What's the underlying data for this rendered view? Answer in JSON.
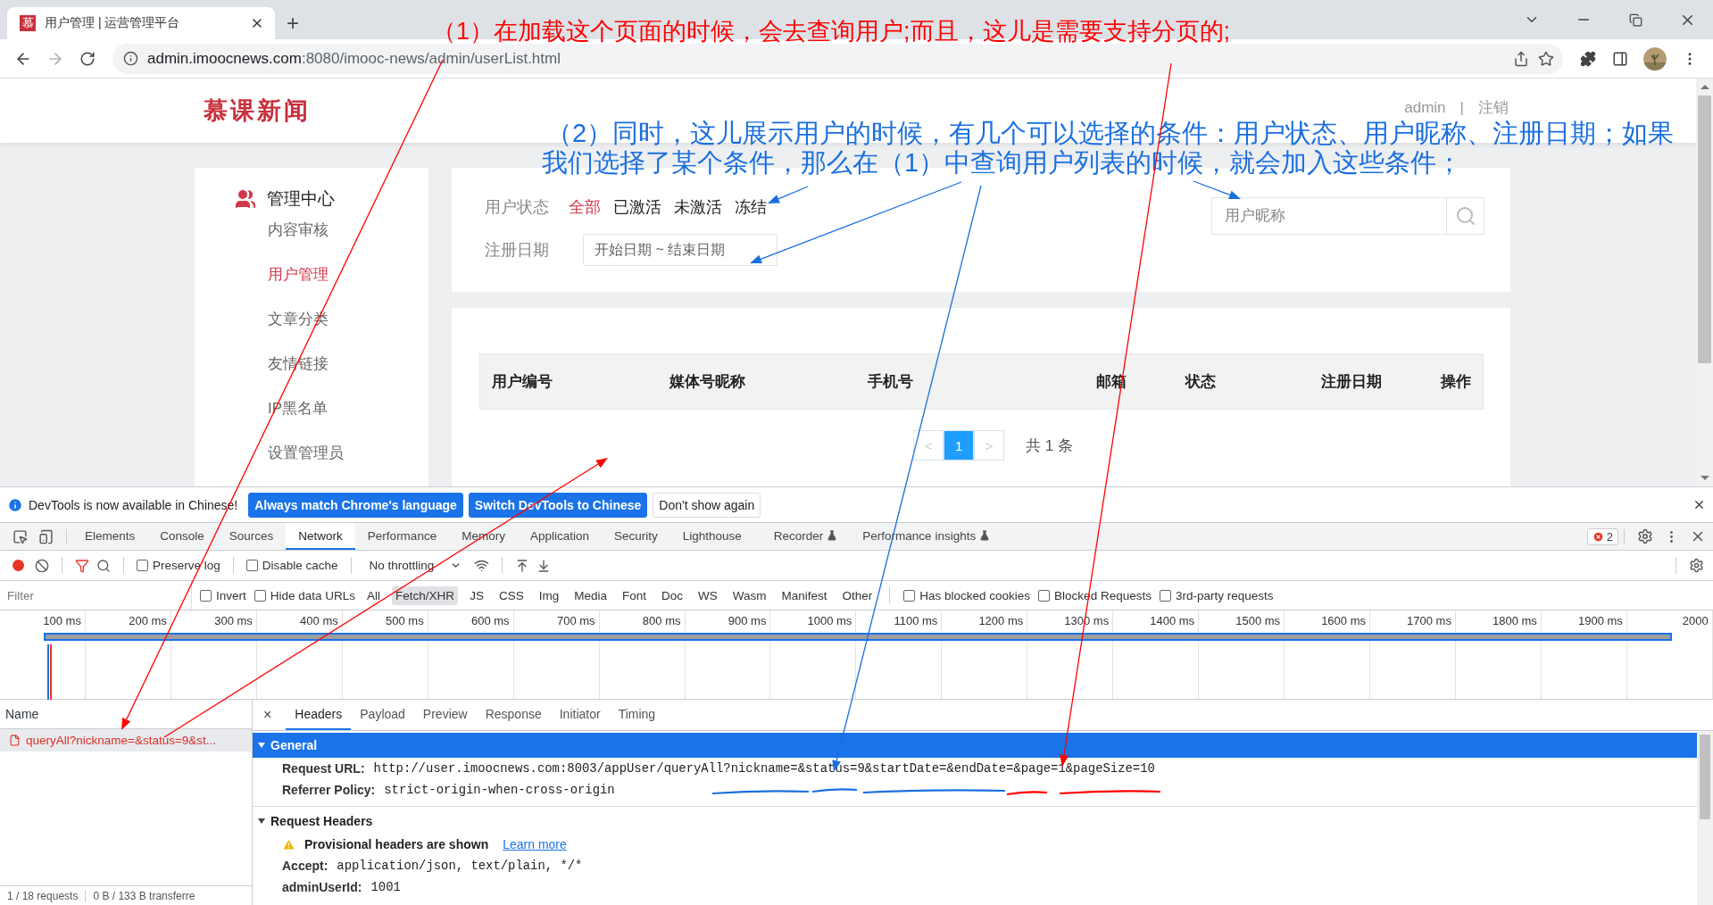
{
  "browser": {
    "favicon": "慕",
    "tab_title": "用户管理 | 运营管理平台",
    "new_tab": "+",
    "url_host": "admin.imoocnews.com",
    "url_path": ":8080/imooc-news/admin/userList.html"
  },
  "site": {
    "logo": "慕课新闻",
    "user": "admin",
    "separator": "|",
    "logout": "注销"
  },
  "sidebar": {
    "title": "管理中心",
    "items": [
      {
        "label": "内容审核",
        "selected": false
      },
      {
        "label": "用户管理",
        "selected": true
      },
      {
        "label": "文章分类",
        "selected": false
      },
      {
        "label": "友情链接",
        "selected": false
      },
      {
        "label": "IP黑名单",
        "selected": false
      },
      {
        "label": "设置管理员",
        "selected": false
      }
    ]
  },
  "filters": {
    "status_label": "用户状态",
    "statuses": [
      {
        "label": "全部",
        "selected": true
      },
      {
        "label": "已激活",
        "selected": false
      },
      {
        "label": "未激活",
        "selected": false
      },
      {
        "label": "冻结",
        "selected": false
      }
    ],
    "date_label": "注册日期",
    "date_placeholder": "开始日期 ~ 结束日期",
    "search_placeholder": "用户昵称"
  },
  "table": {
    "columns": [
      "用户编号",
      "媒体号昵称",
      "手机号",
      "邮箱",
      "状态",
      "注册日期",
      "操作"
    ]
  },
  "pagination": {
    "prev": "<",
    "pages": [
      {
        "label": "1",
        "selected": true
      }
    ],
    "next": ">",
    "total": "共 1 条"
  },
  "devtools": {
    "notice": {
      "text": "DevTools is now available in Chinese!",
      "buttons": [
        {
          "label": "Always match Chrome's language",
          "kind": "primary"
        },
        {
          "label": "Switch DevTools to Chinese",
          "kind": "primary"
        },
        {
          "label": "Don't show again",
          "kind": "plain"
        }
      ]
    },
    "panels": [
      {
        "label": "Elements",
        "selected": false,
        "experimental": false
      },
      {
        "label": "Console",
        "selected": false,
        "experimental": false
      },
      {
        "label": "Sources",
        "selected": false,
        "experimental": false
      },
      {
        "label": "Network",
        "selected": true,
        "experimental": false
      },
      {
        "label": "Performance",
        "selected": false,
        "experimental": false
      },
      {
        "label": "Memory",
        "selected": false,
        "experimental": false
      },
      {
        "label": "Application",
        "selected": false,
        "experimental": false
      },
      {
        "label": "Security",
        "selected": false,
        "experimental": false
      },
      {
        "label": "Lighthouse",
        "selected": false,
        "experimental": false
      },
      {
        "label": "Recorder",
        "selected": false,
        "experimental": true
      },
      {
        "label": "Performance insights",
        "selected": false,
        "experimental": true
      }
    ],
    "error_count": "2",
    "toolbar": {
      "recording": true,
      "options": [
        {
          "label": "Preserve log",
          "checked": false
        },
        {
          "label": "Disable cache",
          "checked": false
        }
      ],
      "throttling": "No throttling"
    },
    "filter_bar": {
      "placeholder": "Filter",
      "options": [
        {
          "label": "Invert",
          "checked": false
        },
        {
          "label": "Hide data URLs",
          "checked": false
        }
      ],
      "types": [
        {
          "label": "All",
          "selected": false
        },
        {
          "label": "Fetch/XHR",
          "selected": true
        },
        {
          "label": "JS",
          "selected": false
        },
        {
          "label": "CSS",
          "selected": false
        },
        {
          "label": "Img",
          "selected": false
        },
        {
          "label": "Media",
          "selected": false
        },
        {
          "label": "Font",
          "selected": false
        },
        {
          "label": "Doc",
          "selected": false
        },
        {
          "label": "WS",
          "selected": false
        },
        {
          "label": "Wasm",
          "selected": false
        },
        {
          "label": "Manifest",
          "selected": false
        },
        {
          "label": "Other",
          "selected": false
        }
      ],
      "extra_options": [
        {
          "label": "Has blocked cookies",
          "checked": false
        },
        {
          "label": "Blocked Requests",
          "checked": false
        },
        {
          "label": "3rd-party requests",
          "checked": false
        }
      ]
    },
    "timeline": {
      "ticks": [
        "100 ms",
        "200 ms",
        "300 ms",
        "400 ms",
        "500 ms",
        "600 ms",
        "700 ms",
        "800 ms",
        "900 ms",
        "1000 ms",
        "1100 ms",
        "1200 ms",
        "1300 ms",
        "1400 ms",
        "1500 ms",
        "1600 ms",
        "1700 ms",
        "1800 ms",
        "1900 ms",
        "2000"
      ]
    },
    "requests": {
      "header": "Name",
      "rows": [
        {
          "name": "queryAll?nickname=&status=9&st...",
          "selected": true,
          "failed": true
        }
      ],
      "status_bar": [
        "1 / 18 requests",
        "0 B / 133 B transferre"
      ]
    },
    "detail": {
      "close": "×",
      "tabs": [
        {
          "label": "Headers",
          "selected": true
        },
        {
          "label": "Payload",
          "selected": false
        },
        {
          "label": "Preview",
          "selected": false
        },
        {
          "label": "Response",
          "selected": false
        },
        {
          "label": "Initiator",
          "selected": false
        },
        {
          "label": "Timing",
          "selected": false
        }
      ],
      "sections": [
        {
          "title": "General",
          "expanded": true,
          "selected": true,
          "rows": [
            {
              "key": "Request URL:",
              "value": "http://user.imoocnews.com:8003/appUser/queryAll?nickname=&status=9&startDate=&endDate=&page=1&pageSize=10"
            },
            {
              "key": "Referrer Policy:",
              "value": "strict-origin-when-cross-origin"
            }
          ]
        },
        {
          "title": "Request Headers",
          "expanded": true,
          "selected": false,
          "warning": {
            "text": "Provisional headers are shown",
            "link": "Learn more"
          },
          "rows": [
            {
              "key": "Accept:",
              "value": "application/json, text/plain, */*"
            },
            {
              "key": "adminUserId:",
              "value": "1001"
            }
          ]
        }
      ]
    }
  },
  "annotations": [
    {
      "text": "（1）在加载这个页面的时候，会去查询用户;而且，这儿是需要支持分页的;",
      "color": "#ff0000"
    },
    {
      "text": "（2）同时，这儿展示用户的时候，有几个可以选择的条件：用户状态、用户昵称、注册日期；如果",
      "color": "#1a6fe0"
    },
    {
      "text": "我们选择了某个条件，那么在（1）中查询用户列表的时候，就会加入这些条件；",
      "color": "#1a6fe0"
    }
  ]
}
